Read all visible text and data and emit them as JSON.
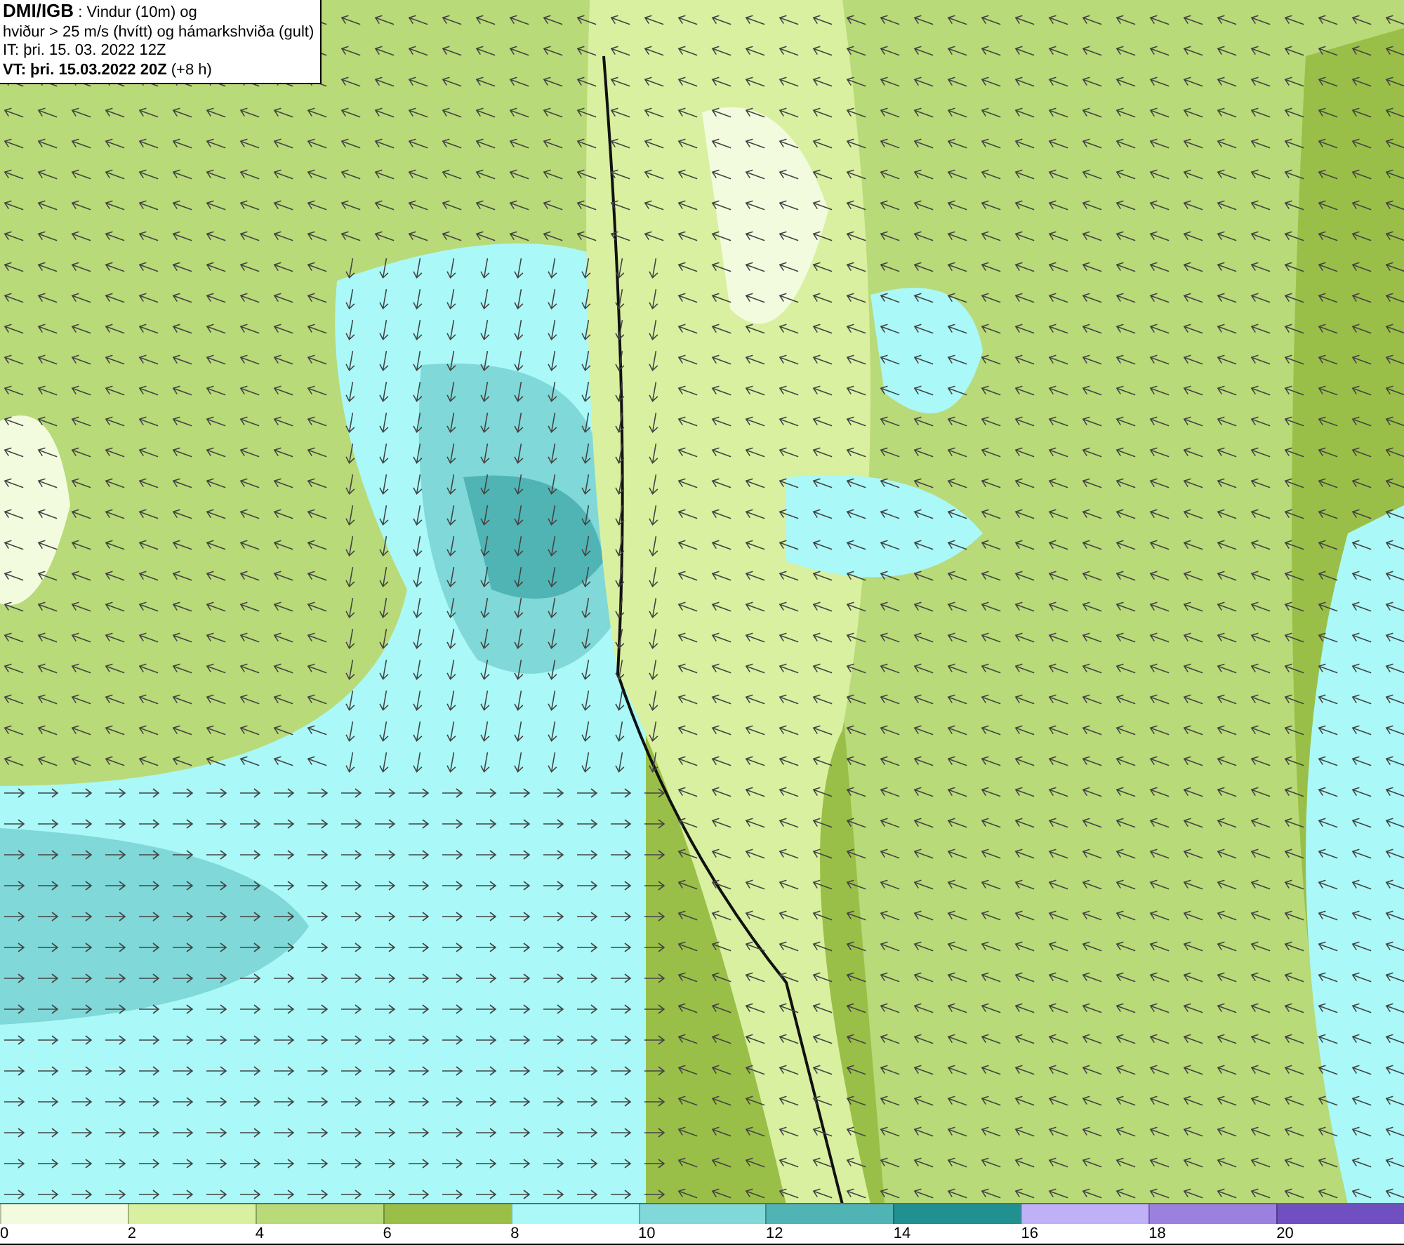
{
  "header": {
    "lines": [
      "**DMI/IGB** : Vindur (10m) og",
      "hviður > 25 m/s (hvítt) og hámarkshviða (gult)",
      "IT: þri. 15. 03. 2022 12Z",
      "**VT: þri. 15.03.2022 20Z** (+8 h)"
    ]
  },
  "legend": [
    {
      "label": "0",
      "color": "#f3fbdf"
    },
    {
      "label": "2",
      "color": "#d8f0a0"
    },
    {
      "label": "4",
      "color": "#b8da78"
    },
    {
      "label": "6",
      "color": "#9abf48"
    },
    {
      "label": "8",
      "color": "#aaf8f8"
    },
    {
      "label": "10",
      "color": "#80d8d8"
    },
    {
      "label": "12",
      "color": "#50b4b4"
    },
    {
      "label": "14",
      "color": "#209090"
    },
    {
      "label": "16",
      "color": "#c0b0f8"
    },
    {
      "label": "18",
      "color": "#9c80e0"
    },
    {
      "label": "20",
      "color": "#7050c0"
    }
  ]
}
